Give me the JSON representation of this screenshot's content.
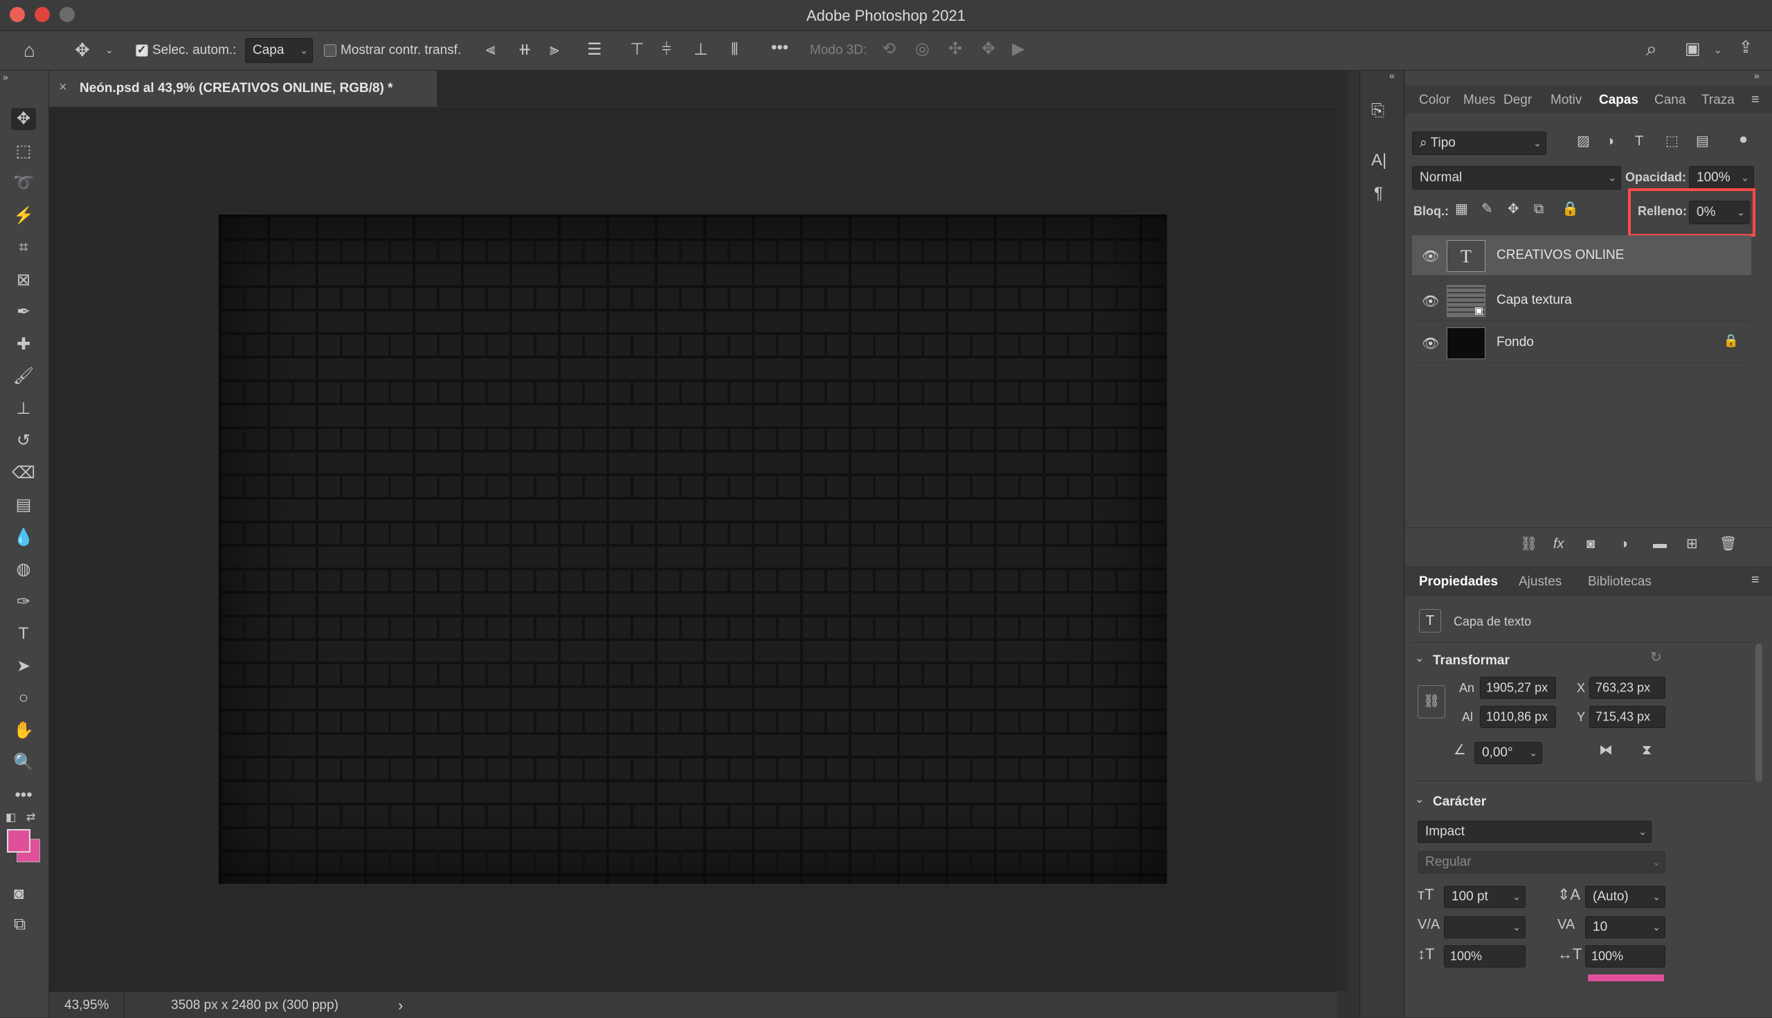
{
  "window": {
    "title": "Adobe Photoshop 2021",
    "traffic_lights": [
      "#ec5f57",
      "#e0443e",
      "#6b6b6b"
    ]
  },
  "options_bar": {
    "auto_select_label": "Selec. autom.:",
    "auto_select_checked": true,
    "target_value": "Capa",
    "show_transform_label": "Mostrar contr. transf.",
    "show_transform_checked": false,
    "mode_3d_label": "Modo 3D:",
    "more_glyph": "•••"
  },
  "document": {
    "tab_title": "Neón.psd al 43,9% (CREATIVOS  ONLINE, RGB/8) *",
    "close_glyph": "×"
  },
  "status_bar": {
    "zoom": "43,95%",
    "doc_info": "3508 px x 2480 px (300 ppp)",
    "arrow": "›"
  },
  "tools": [
    {
      "name": "move-tool-icon",
      "glyph": "✥"
    },
    {
      "name": "marquee-tool-icon",
      "glyph": "⬚"
    },
    {
      "name": "lasso-tool-icon",
      "glyph": "➰"
    },
    {
      "name": "magic-wand-tool-icon",
      "glyph": "⚡"
    },
    {
      "name": "crop-tool-icon",
      "glyph": "⌗"
    },
    {
      "name": "frame-tool-icon",
      "glyph": "⊠"
    },
    {
      "name": "eyedropper-tool-icon",
      "glyph": "✒"
    },
    {
      "name": "healing-brush-tool-icon",
      "glyph": "✚"
    },
    {
      "name": "brush-tool-icon",
      "glyph": "🖌"
    },
    {
      "name": "clone-stamp-tool-icon",
      "glyph": "⊥"
    },
    {
      "name": "history-brush-tool-icon",
      "glyph": "↺"
    },
    {
      "name": "eraser-tool-icon",
      "glyph": "⌫"
    },
    {
      "name": "gradient-tool-icon",
      "glyph": "▤"
    },
    {
      "name": "blur-tool-icon",
      "glyph": "💧"
    },
    {
      "name": "sponge-tool-icon",
      "glyph": "◍"
    },
    {
      "name": "pen-tool-icon",
      "glyph": "✑"
    },
    {
      "name": "type-tool-icon",
      "glyph": "T"
    },
    {
      "name": "path-selection-tool-icon",
      "glyph": "➤"
    },
    {
      "name": "ellipse-tool-icon",
      "glyph": "○"
    },
    {
      "name": "hand-tool-icon",
      "glyph": "✋"
    },
    {
      "name": "zoom-tool-icon",
      "glyph": "🔍"
    },
    {
      "name": "more-tools-icon",
      "glyph": "•••"
    }
  ],
  "colors": {
    "foreground": "#e0509a",
    "background": "#e0509a",
    "highlight_box": "#ff4a4a"
  },
  "panel_tabs_top": [
    "Color",
    "Mues",
    "Degr",
    "Motiv",
    "Capas",
    "Cana",
    "Traza"
  ],
  "panel_tabs_top_active": "Capas",
  "layers_panel": {
    "filter_kind": "Tipo",
    "blend_mode": "Normal",
    "opacity_label": "Opacidad:",
    "opacity_value": "100%",
    "lock_label": "Bloq.:",
    "fill_label": "Relleno:",
    "fill_value": "0%",
    "layers": [
      {
        "name": "CREATIVOS  ONLINE",
        "type": "text",
        "selected": true
      },
      {
        "name": "Capa textura",
        "type": "smart",
        "selected": false
      },
      {
        "name": "Fondo",
        "type": "background",
        "selected": false,
        "locked": true
      }
    ]
  },
  "panel_tabs_bottom": [
    "Propiedades",
    "Ajustes",
    "Bibliotecas"
  ],
  "panel_tabs_bottom_active": "Propiedades",
  "properties": {
    "layer_type_label": "Capa de texto",
    "transform": {
      "title": "Transformar",
      "w_label": "An",
      "w_value": "1905,27 px",
      "h_label": "Al",
      "h_value": "1010,86 px",
      "x_label": "X",
      "x_value": "763,23 px",
      "y_label": "Y",
      "y_value": "715,43 px",
      "angle_value": "0,00°"
    },
    "character": {
      "title": "Carácter",
      "font_family": "Impact",
      "font_style": "Regular",
      "font_size": "100 pt",
      "leading": "(Auto)",
      "kerning": "",
      "tracking": "10",
      "vertical_scale": "100%",
      "horizontal_scale": "100%"
    }
  }
}
